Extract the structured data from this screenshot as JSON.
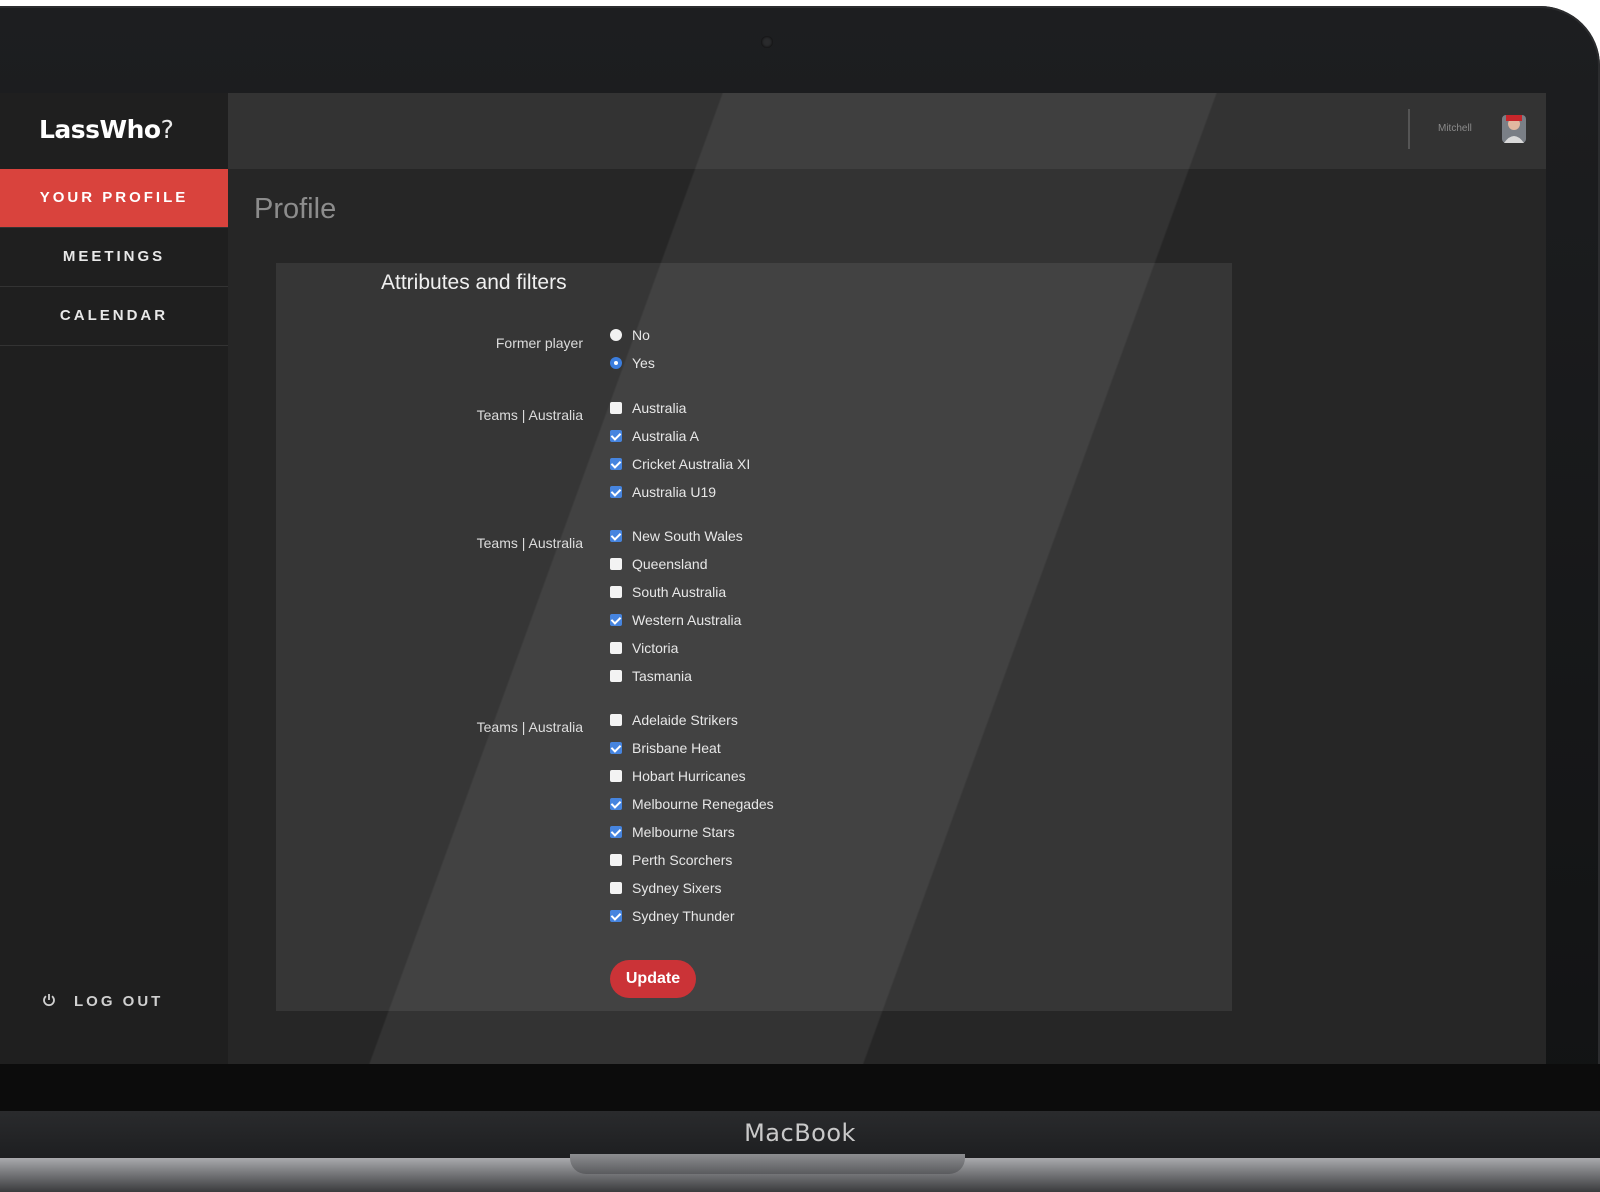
{
  "device_label": "MacBook",
  "app": {
    "logo": "LassWho",
    "logo_mark": "?"
  },
  "sidebar": {
    "items": [
      {
        "label": "YOUR PROFILE",
        "active": true
      },
      {
        "label": "MEETINGS",
        "active": false
      },
      {
        "label": "CALENDAR",
        "active": false
      }
    ],
    "logout_label": "LOG OUT"
  },
  "header": {
    "user_name": "Mitchell"
  },
  "page": {
    "title": "Profile"
  },
  "form": {
    "title": "Attributes and filters",
    "former_player": {
      "label": "Former player",
      "options": [
        {
          "label": "No",
          "checked": false
        },
        {
          "label": "Yes",
          "checked": true
        }
      ]
    },
    "groups": [
      {
        "label": "Teams | Australia",
        "options": [
          {
            "label": "Australia",
            "checked": false
          },
          {
            "label": "Australia A",
            "checked": true
          },
          {
            "label": "Cricket Australia XI",
            "checked": true
          },
          {
            "label": "Australia U19",
            "checked": true
          }
        ]
      },
      {
        "label": "Teams | Australia",
        "options": [
          {
            "label": "New South Wales",
            "checked": true
          },
          {
            "label": "Queensland",
            "checked": false
          },
          {
            "label": "South Australia",
            "checked": false
          },
          {
            "label": "Western Australia",
            "checked": true
          },
          {
            "label": "Victoria",
            "checked": false
          },
          {
            "label": "Tasmania",
            "checked": false
          }
        ]
      },
      {
        "label": "Teams | Australia",
        "options": [
          {
            "label": "Adelaide Strikers",
            "checked": false
          },
          {
            "label": "Brisbane Heat",
            "checked": true
          },
          {
            "label": "Hobart Hurricanes",
            "checked": false
          },
          {
            "label": "Melbourne Renegades",
            "checked": true
          },
          {
            "label": "Melbourne Stars",
            "checked": true
          },
          {
            "label": "Perth Scorchers",
            "checked": false
          },
          {
            "label": "Sydney Sixers",
            "checked": false
          },
          {
            "label": "Sydney Thunder",
            "checked": true
          }
        ]
      }
    ],
    "submit_label": "Update"
  },
  "colors": {
    "accent": "#d9433d",
    "button": "#c8262b",
    "checkbox_checked": "#3b7ddd"
  }
}
